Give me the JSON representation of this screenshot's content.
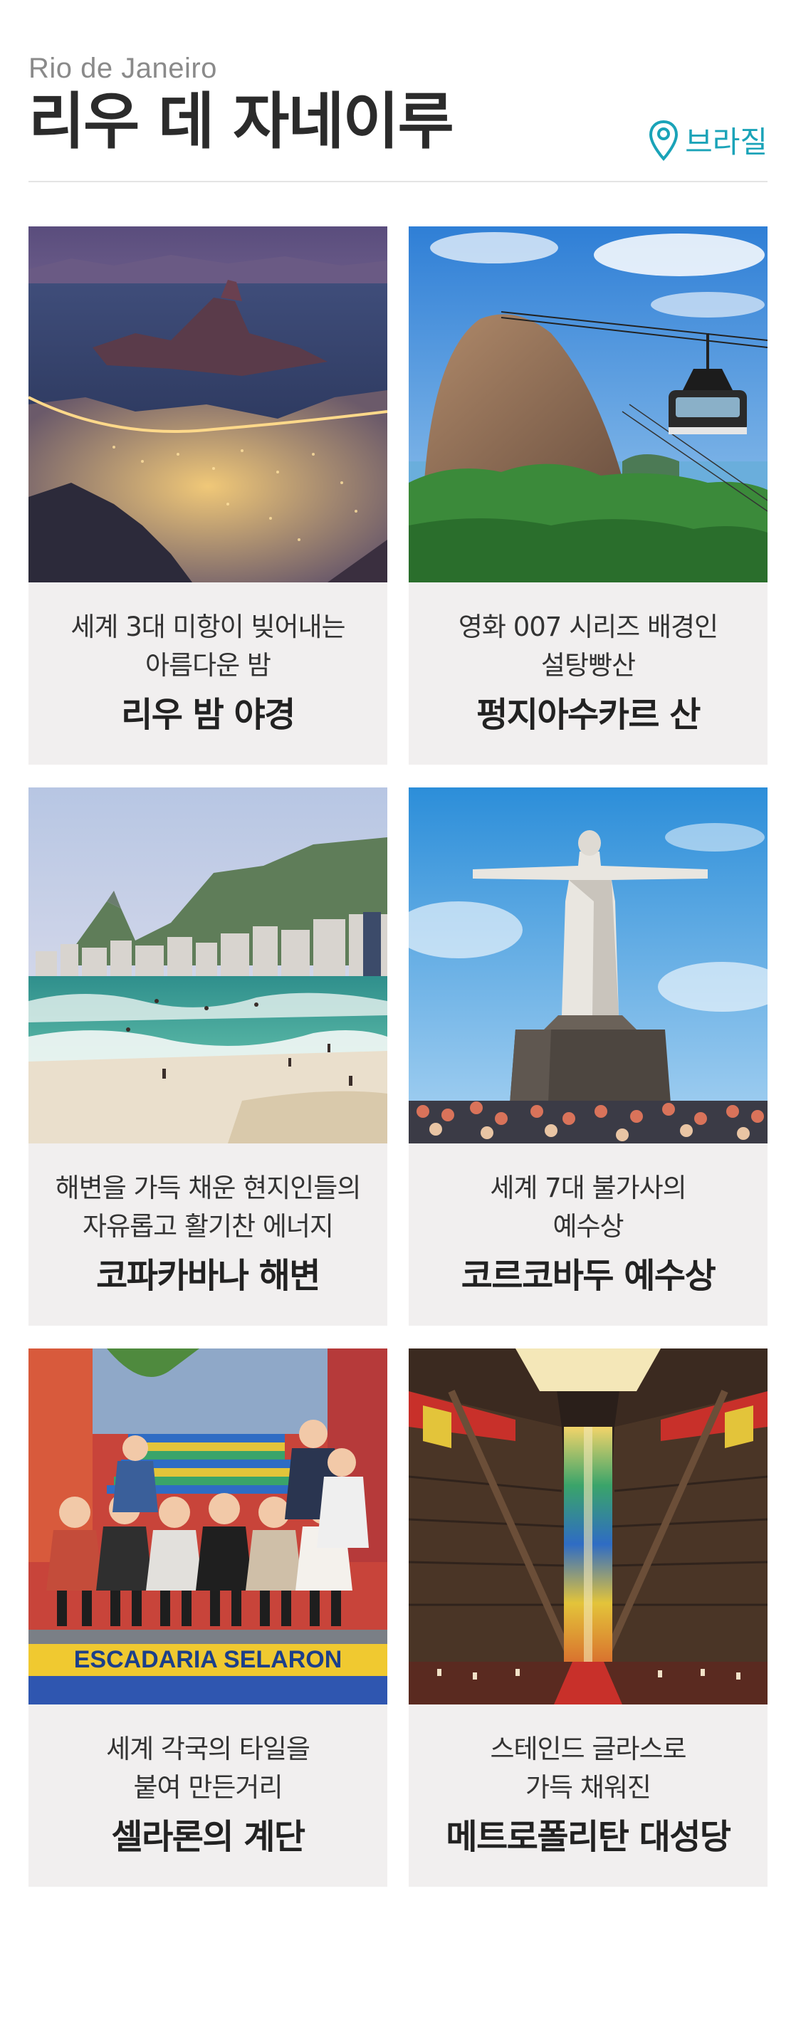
{
  "header": {
    "subtitle": "Rio de Janeiro",
    "title": "리우 데 자네이루",
    "location_label": "브라질",
    "location_icon": "map-pin-icon",
    "accent_color": "#1aa3b8"
  },
  "cards": [
    {
      "desc_line1": "세계 3대 미항이 빚어내는",
      "desc_line2": "아름다운 밤",
      "name": "리우 밤 야경"
    },
    {
      "desc_line1": "영화 007 시리즈 배경인",
      "desc_line2": "설탕빵산",
      "name": "펑지아수카르 산"
    },
    {
      "desc_line1": "해변을 가득 채운 현지인들의",
      "desc_line2": "자유롭고 활기찬 에너지",
      "name": "코파카바나 해변"
    },
    {
      "desc_line1": "세계 7대 불가사의",
      "desc_line2": "예수상",
      "name": "코르코바두 예수상"
    },
    {
      "desc_line1": "세계 각국의 타일을",
      "desc_line2": "붙여 만든거리",
      "name": "셀라론의 계단",
      "photo_sign_text": "ESCADARIA SELARON"
    },
    {
      "desc_line1": "스테인드 글라스로",
      "desc_line2": "가득 채워진",
      "name": "메트로폴리탄 대성당"
    }
  ]
}
